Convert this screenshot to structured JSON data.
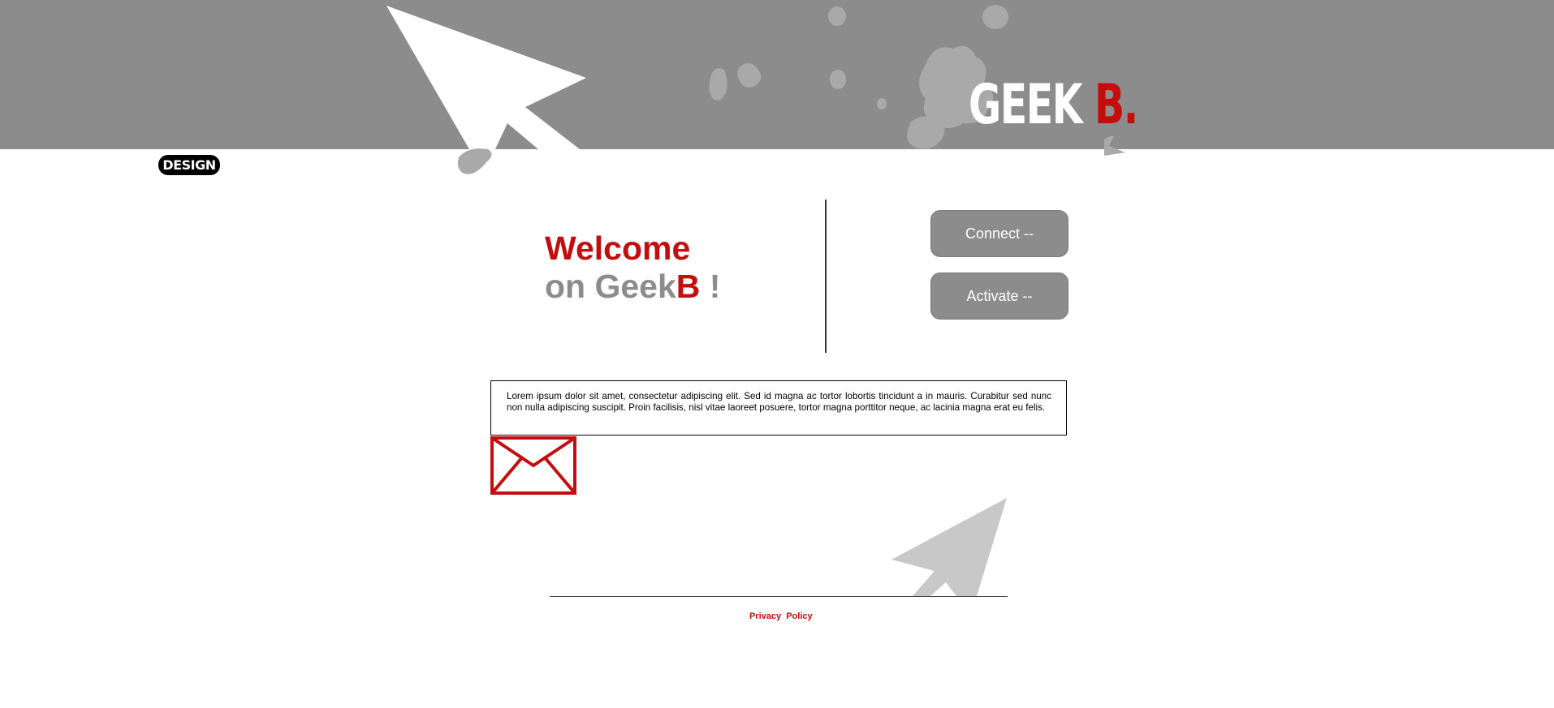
{
  "header": {
    "logo_text": "GEEK ",
    "logo_accent": "B.",
    "badge": "DESIGN"
  },
  "welcome": {
    "line1": "Welcome",
    "line2_prefix": "on Geek",
    "line2_accent": "B",
    "line2_suffix": " !"
  },
  "actions": {
    "connect_label": "Connect --",
    "activate_label": "Activate --"
  },
  "content": {
    "paragraph": "Lorem ipsum dolor sit amet, consectetur adipiscing elit. Sed id magna ac tortor lobortis tincidunt a in mauris. Curabitur sed nunc non nulla adipiscing suscipit. Proin facilisis, nisl vitae laoreet posuere, tortor magna porttitor neque, ac lacinia magna erat eu felis."
  },
  "footer": {
    "privacy_label": "Privacy Policy"
  },
  "colors": {
    "accent": "#c50d0d",
    "banner": "#8c8c8c",
    "button": "#8c8c8c"
  },
  "icons": {
    "mail": "envelope-icon",
    "cursor": "cursor-arrow-icon"
  }
}
